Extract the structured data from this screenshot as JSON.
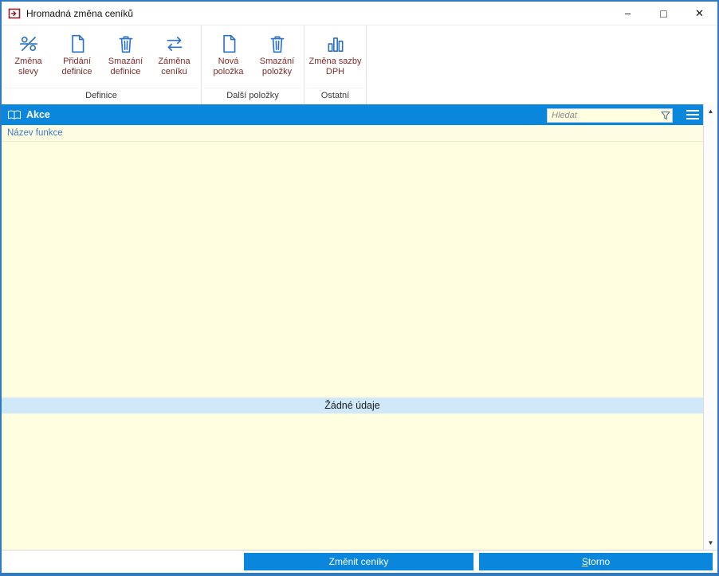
{
  "window": {
    "title": "Hromadná změna ceníků",
    "minimize_glyph": "–",
    "maximize_glyph": "□",
    "close_glyph": "✕"
  },
  "toolbar": {
    "groups": [
      {
        "label": "Definice",
        "buttons": [
          {
            "label": "Změna slevy",
            "icon": "discount-change-icon"
          },
          {
            "label": "Přidání definice",
            "icon": "document-new-icon"
          },
          {
            "label": "Smazání definice",
            "icon": "trash-icon"
          },
          {
            "label": "Záměna ceníku",
            "icon": "swap-arrows-icon"
          }
        ]
      },
      {
        "label": "Další položky",
        "buttons": [
          {
            "label": "Nová položka",
            "icon": "document-new-icon"
          },
          {
            "label": "Smazání položky",
            "icon": "trash-icon"
          }
        ]
      },
      {
        "label": "Ostatní",
        "buttons": [
          {
            "label": "Změna sazby DPH",
            "icon": "bar-chart-icon"
          }
        ]
      }
    ]
  },
  "panel": {
    "title": "Akce",
    "search_placeholder": "Hledat",
    "column_header": "Název funkce",
    "empty_text": "Žádné údaje"
  },
  "scrollbar": {
    "up_glyph": "▲",
    "down_glyph": "▼"
  },
  "footer": {
    "change_label": "Změnit ceníky",
    "cancel_label_accel": "S",
    "cancel_label_rest": "torno"
  },
  "colors": {
    "accent_blue": "#0a86dd",
    "window_border": "#2e7bc4",
    "cream": "#fffee1",
    "empty_row_blue": "#cfe9fb",
    "toolbar_label_red": "#7d2b29",
    "icon_blue": "#2a72c3",
    "column_header_text": "#3e7cc0"
  }
}
